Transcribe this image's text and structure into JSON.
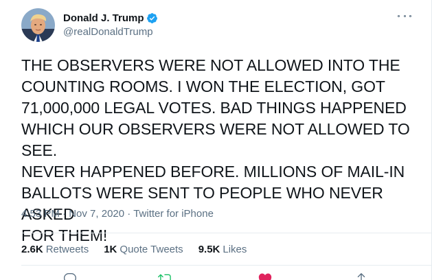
{
  "user": {
    "display_name": "Donald J. Trump",
    "handle": "@realDonaldTrump",
    "verified": true
  },
  "tweet": {
    "text": "THE OBSERVERS WERE NOT ALLOWED INTO THE\nCOUNTING ROOMS. I WON THE ELECTION, GOT\n71,000,000 LEGAL VOTES. BAD THINGS HAPPENED\nWHICH OUR OBSERVERS WERE NOT ALLOWED TO SEE.\nNEVER HAPPENED BEFORE. MILLIONS OF MAIL-IN\nBALLOTS WERE SENT TO PEOPLE WHO NEVER ASKED\nFOR THEM!",
    "time": "4:53 PM",
    "separator": "·",
    "date": "Nov 7, 2020",
    "source": "Twitter for iPhone"
  },
  "stats": {
    "retweets_count": "2.6K",
    "retweets_label": "Retweets",
    "quotes_count": "1K",
    "quotes_label": "Quote Tweets",
    "likes_count": "9.5K",
    "likes_label": "Likes"
  },
  "colors": {
    "text": "#0f1419",
    "secondary": "#5b7083",
    "verified": "#1da1f2",
    "divider": "#e6ecf0",
    "retweet": "#17bf63",
    "like": "#e0245e"
  },
  "icons": {
    "verified": "verified-badge-icon",
    "more": "more-options-icon",
    "reply": "reply-icon",
    "retweet": "retweet-icon",
    "like": "heart-icon",
    "share": "share-icon"
  }
}
